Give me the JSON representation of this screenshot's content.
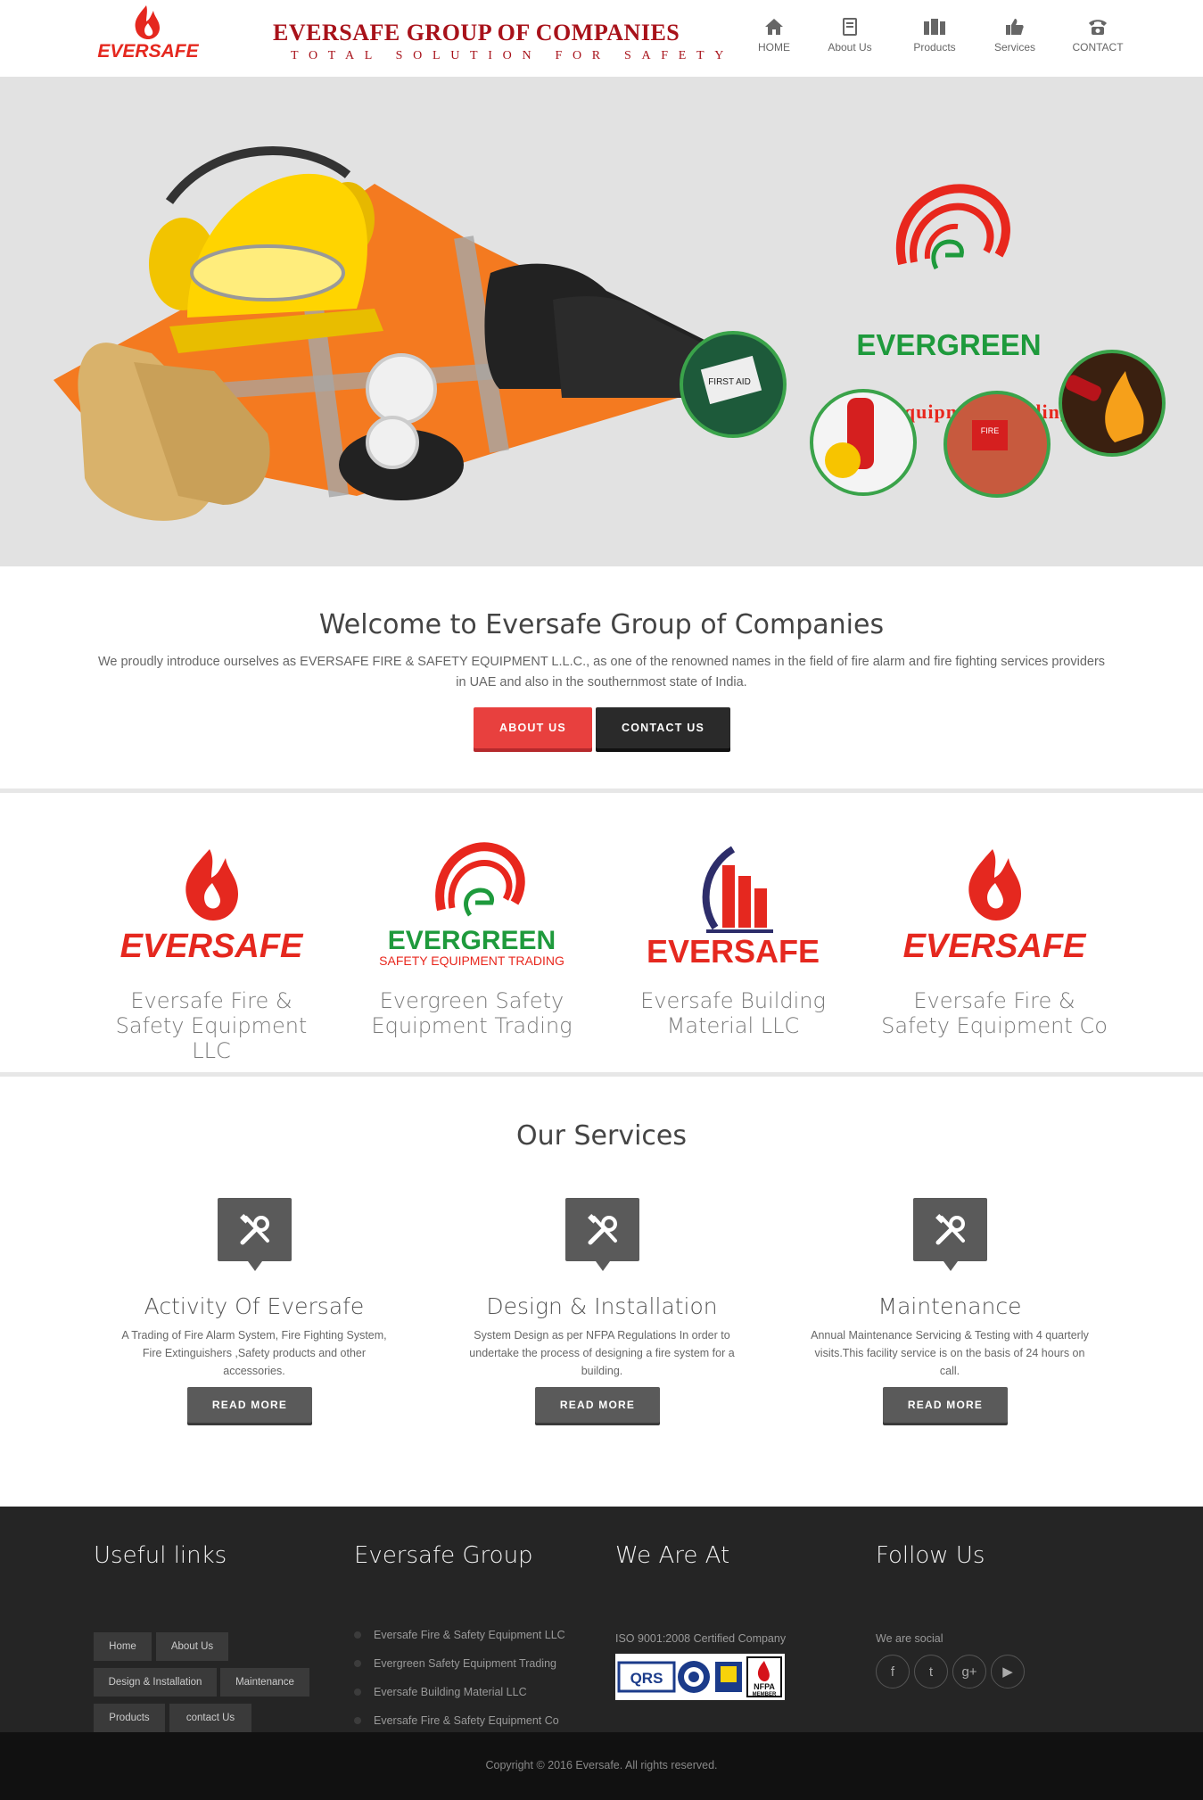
{
  "header": {
    "logo_text": "EVERSAFE",
    "title": "EVERSAFE GROUP OF COMPANIES",
    "tagline": "TOTAL SOLUTION FOR SAFETY",
    "nav": [
      {
        "label": "HOME",
        "icon": "home-icon"
      },
      {
        "label": "About Us",
        "icon": "document-icon"
      },
      {
        "label": "Products",
        "icon": "products-icon"
      },
      {
        "label": "Services",
        "icon": "thumbs-up-icon"
      },
      {
        "label": "CONTACT",
        "icon": "telephone-icon"
      }
    ]
  },
  "hero": {
    "brand": "EVERGREEN",
    "subtitle": "Safety Equipment Trading",
    "first_aid_label": "FIRST AID",
    "fire_label": "FIRE"
  },
  "welcome": {
    "title": "Welcome to Eversafe Group of Companies",
    "text": "We proudly introduce ourselves as EVERSAFE FIRE & SAFETY EQUIPMENT L.L.C., as one of the renowned names in the field of fire alarm and fire fighting services providers in UAE and also in the southernmost state of India.",
    "about_btn": "ABOUT US",
    "contact_btn": "CONTACT US"
  },
  "companies": [
    {
      "logo_text": "EVERSAFE",
      "name": "Eversafe Fire & Safety Equipment LLC"
    },
    {
      "logo_text": "EVERGREEN",
      "logo_sub": "SAFETY EQUIPMENT TRADING",
      "name": "Evergreen Safety Equipment Trading"
    },
    {
      "logo_text": "EVERSAFE",
      "name": "Eversafe Building Material LLC"
    },
    {
      "logo_text": "EVERSAFE",
      "name": "Eversafe Fire & Safety Equipment Co"
    }
  ],
  "services": {
    "title": "Our Services",
    "items": [
      {
        "title": "Activity Of Eversafe",
        "desc": "A Trading of Fire Alarm System, Fire Fighting System, Fire Extinguishers ,Safety products and other accessories.",
        "btn": "READ MORE",
        "icon": "tools-icon"
      },
      {
        "title": "Design & Installation",
        "desc": "System Design as per NFPA Regulations In order to undertake the process of designing a fire system for a building.",
        "btn": "READ MORE",
        "icon": "tools-icon"
      },
      {
        "title": "Maintenance",
        "desc": "Annual Maintenance Servicing & Testing with 4 quarterly visits.This facility service is on the basis of 24 hours on call.",
        "btn": "READ MORE",
        "icon": "tools-icon"
      }
    ]
  },
  "footer": {
    "useful_links": {
      "title": "Useful links",
      "links": [
        "Home",
        "About Us",
        "Design & Installation",
        "Maintenance",
        "Products",
        "contact Us"
      ]
    },
    "group": {
      "title": "Eversafe Group",
      "items": [
        "Eversafe Fire & Safety Equipment LLC",
        "Evergreen Safety Equipment Trading",
        "Eversafe Building Material LLC",
        "Eversafe Fire & Safety Equipment Co"
      ]
    },
    "located": {
      "title": "We Are At",
      "text": "ISO 9001:2008 Certified Company",
      "cert_qrs": "QRS",
      "cert_nfpa": "NFPA",
      "cert_member": "MEMBER"
    },
    "follow": {
      "title": "Follow Us",
      "text": "We are social",
      "networks": [
        {
          "name": "facebook",
          "glyph": "f"
        },
        {
          "name": "twitter",
          "glyph": "t"
        },
        {
          "name": "google-plus",
          "glyph": "g+"
        },
        {
          "name": "youtube",
          "glyph": "▶"
        }
      ]
    },
    "copyright": "Copyright © 2016 Eversafe. All rights reserved."
  },
  "colors": {
    "brand_red": "#a8121a",
    "accent_red": "#e8403e",
    "evergreen_green": "#1e9a3c",
    "footer_bg": "#252525",
    "hero_bg": "#e2e2e2"
  }
}
